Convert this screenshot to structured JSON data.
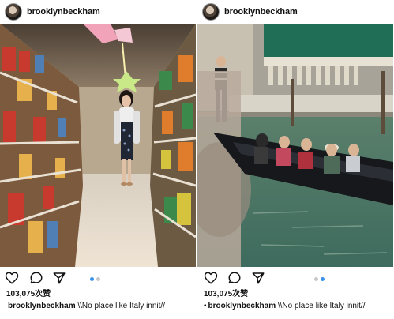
{
  "posts": [
    {
      "username": "brooklynbeckham",
      "photo_icon": "grocery-aisle-photo",
      "likes": "103,075次赞",
      "caption_prefix": "",
      "caption_user": "brooklynbeckham",
      "caption_text": " \\\\No place like Italy innit//"
    },
    {
      "username": "brooklynbeckham",
      "photo_icon": "venice-gondola-photo",
      "likes": "103,075次赞",
      "caption_prefix": "•",
      "caption_user": "brooklynbeckham",
      "caption_text": " \\\\No place like Italy innit//"
    }
  ],
  "icons": {
    "like": "heart-icon",
    "comment": "comment-icon",
    "share": "share-icon"
  },
  "colors": {
    "active_dot": "#3a93ea",
    "inactive_dot": "#c7c7c7"
  }
}
